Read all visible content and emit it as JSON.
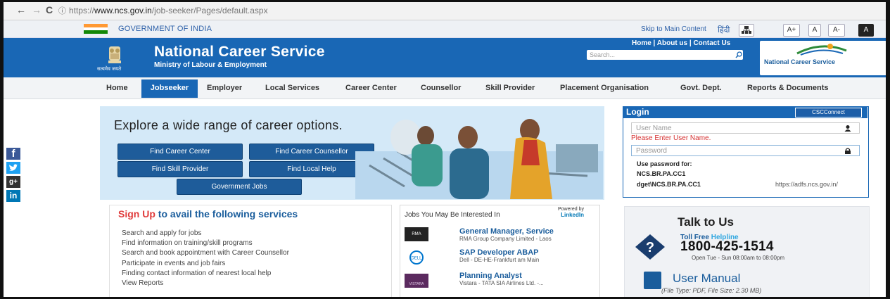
{
  "browser": {
    "back": "←",
    "forward": "→",
    "reload": "C",
    "url_prefix": "https://",
    "url_host": "www.ncs.gov.in",
    "url_path": "/job-seeker/Pages/default.aspx"
  },
  "gov_strip": {
    "label": "GOVERNMENT OF INDIA",
    "skip": "Skip to Main Content",
    "hindi": "हिंदी",
    "font_larger": "A+",
    "font_normal": "A",
    "font_smaller": "A-",
    "contrast": "A"
  },
  "header": {
    "emblem_caption": "सत्यमेव जयते",
    "title": "National Career Service",
    "subtitle": "Ministry of Labour & Employment",
    "links": "Home | About us | Contact Us",
    "search_placeholder": "Search...",
    "logo_text": "National Career Service"
  },
  "menu": [
    "Home",
    "Jobseeker",
    "Employer",
    "Local Services",
    "Career Center",
    "Counsellor",
    "Skill Provider",
    "Placement Organisation",
    "Govt. Dept.",
    "Reports & Documents"
  ],
  "social": [
    "f",
    "t",
    "g+",
    "in"
  ],
  "banner": {
    "title": "Explore a wide range of career options.",
    "buttons": [
      "Find Career Center",
      "Find Career Counsellor",
      "Find Skill Provider",
      "Find Local Help",
      "Government Jobs"
    ]
  },
  "login": {
    "title": "Login",
    "csc": "CSCConnect",
    "username_placeholder": "User Name",
    "error": "Please Enter User Name.",
    "password_placeholder": "Password",
    "note": "Use password for:",
    "account1": "NCS.BR.PA.CC1",
    "account2": "dget\\NCS.BR.PA.CC1",
    "adfs": "https://adfs.ncs.gov.in/"
  },
  "signup": {
    "highlight": "Sign Up",
    "rest": " to avail the following services",
    "items": [
      "Search and apply for jobs",
      "Find information on training/skill programs",
      "Search and book appointment with Career Counsellor",
      "Participate in events and job fairs",
      "Finding contact information of nearest local help",
      "View Reports"
    ]
  },
  "jobs": {
    "title": "Jobs You May Be Interested In",
    "powered_by": "Powered by",
    "linkedin": "LinkedIn",
    "items": [
      {
        "title": "General Manager, Service",
        "company": "RMA Group Company Limited - Laos",
        "logo": "RMA"
      },
      {
        "title": "SAP Developer ABAP",
        "company": "Dell - DE-HE-Frankfurt am Main",
        "logo": "DELL"
      },
      {
        "title": "Planning Analyst",
        "company": "Vistara - TATA SIA Airlines Ltd. -...",
        "logo": "VISTARA"
      }
    ]
  },
  "talk": {
    "title": "Talk to Us",
    "toll": "Toll Free",
    "helpline": " Helpline",
    "phone": "1800-425-1514",
    "hours": "Open Tue - Sun 08:00am to 08:00pm",
    "manual": "User Manual",
    "filetype": "(File Type: PDF, File Size: 2.30 MB)"
  },
  "colors": {
    "primary_blue": "#1967b5",
    "banner_bg": "#d4e9f8",
    "button_blue": "#1e5c9a",
    "error_red": "#d63333",
    "signup_red": "#e03c3c",
    "facebook": "#3b5998",
    "twitter": "#1da1f2",
    "googleplus": "#333333",
    "linkedin": "#0077b5"
  }
}
